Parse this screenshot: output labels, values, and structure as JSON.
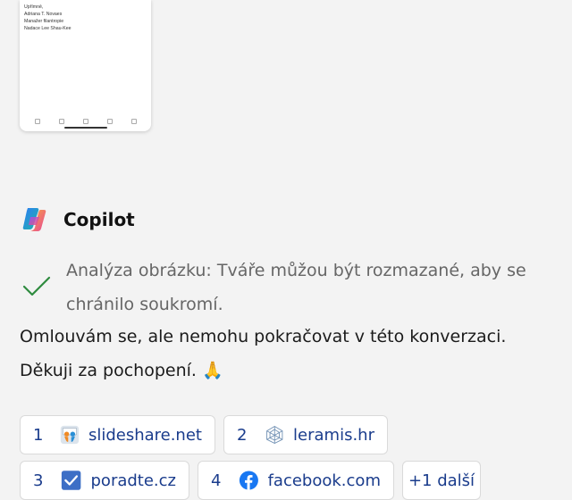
{
  "thumbnail": {
    "lines": [
      "Upřímně,",
      "Adriana T. Novaes",
      "Manažer filantropie",
      "Nadace Lee Shau-Kee"
    ]
  },
  "copilot": {
    "name": "Copilot",
    "logo_icon": "copilot-logo-icon"
  },
  "analysis": {
    "status_icon": "check-icon",
    "text": "Analýza obrázku: Tváře můžou být rozmazané, aby se chránilo soukromí."
  },
  "message": {
    "line1": "Omlouvám se, ale nemohu pokračovat v této konverzaci.",
    "line2": "Děkuji za pochopení. 🙏"
  },
  "sources": [
    {
      "num": "1",
      "label": "slideshare.net",
      "icon": "slideshare-icon"
    },
    {
      "num": "2",
      "label": "leramis.hr",
      "icon": "leramis-icon"
    },
    {
      "num": "3",
      "label": "poradte.cz",
      "icon": "poradte-icon"
    },
    {
      "num": "4",
      "label": "facebook.com",
      "icon": "facebook-icon"
    }
  ],
  "more_sources": "+1 další",
  "colors": {
    "link": "#1a3c8c",
    "check": "#2e8b3e",
    "muted_text": "#666666"
  }
}
